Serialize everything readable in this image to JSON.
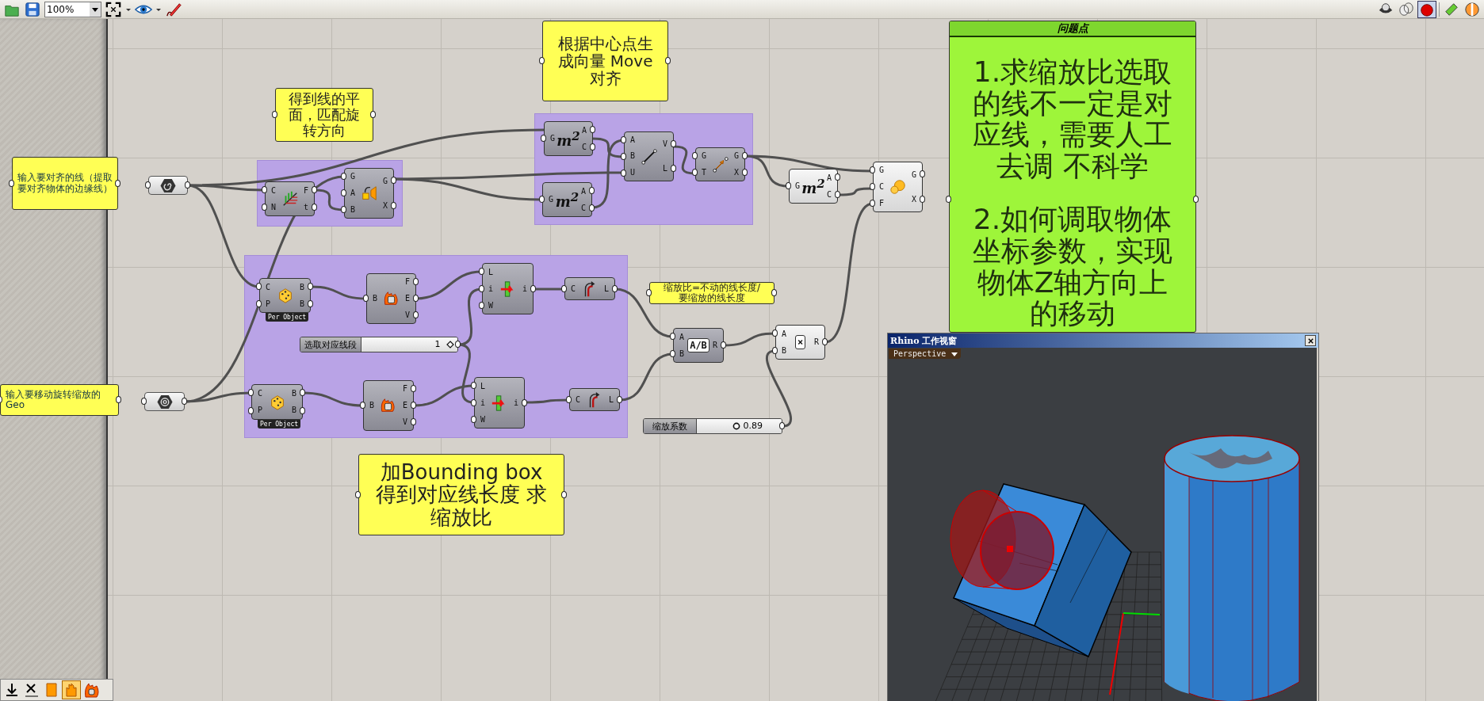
{
  "toolbar": {
    "zoom": "100%"
  },
  "panels": [
    {
      "text": "输入要对齐的线（提取要对齐物体的边缘线）"
    },
    {
      "text": "输入要移动旋转缩放的Geo"
    }
  ],
  "params": [
    {
      "kind": "curve"
    },
    {
      "kind": "geometry"
    }
  ],
  "notes": [
    {
      "text": "得到线的平面，匹配旋转方向"
    },
    {
      "text": "根据中心点生成向量 Move 对齐"
    },
    {
      "text": "缩放比=不动的线长度/要缩放的线长度"
    },
    {
      "text": "加Bounding box 得到对应线长度 求缩放比"
    }
  ],
  "components": [
    {
      "kind": "perp-frame",
      "inputs": [
        "C",
        "N"
      ],
      "outputs": [
        "F",
        "t"
      ],
      "preview": false
    },
    {
      "kind": "orient",
      "inputs": [
        "G",
        "A",
        "B"
      ],
      "outputs": [
        "G",
        "X"
      ],
      "preview": false
    },
    {
      "kind": "area",
      "icon_text": "m$^{2}$",
      "inputs": [
        "G"
      ],
      "outputs": [
        "A",
        "C"
      ],
      "preview": false
    },
    {
      "kind": "vector",
      "inputs": [
        "A",
        "B",
        "U"
      ],
      "outputs": [
        "V",
        "L"
      ],
      "preview": false
    },
    {
      "kind": "area",
      "icon_text": "m$^{2}$",
      "inputs": [
        "G"
      ],
      "outputs": [
        "A",
        "C"
      ],
      "preview": false
    },
    {
      "kind": "move",
      "inputs": [
        "G",
        "T"
      ],
      "outputs": [
        "G",
        "X"
      ],
      "preview": false
    },
    {
      "kind": "area",
      "icon_text": "m$^{2}$",
      "inputs": [
        "G"
      ],
      "outputs": [
        "A",
        "C"
      ],
      "preview": true
    },
    {
      "kind": "scale",
      "inputs": [
        "G",
        "C",
        "F"
      ],
      "outputs": [
        "G",
        "X"
      ],
      "preview": true
    },
    {
      "kind": "bbox",
      "tag": "Per Object",
      "inputs": [
        "C",
        "P"
      ],
      "outputs": [
        "B",
        "B"
      ],
      "preview": false
    },
    {
      "kind": "deconstruct",
      "inputs": [
        "B"
      ],
      "outputs": [
        "F",
        "E",
        "V"
      ],
      "preview": false
    },
    {
      "kind": "list-item",
      "inputs": [
        "L",
        "i",
        "W"
      ],
      "outputs": [
        "i"
      ],
      "preview": false
    },
    {
      "kind": "length",
      "inputs": [
        "C"
      ],
      "outputs": [
        "L"
      ],
      "preview": false
    },
    {
      "kind": "bbox",
      "tag": "Per Object",
      "inputs": [
        "C",
        "P"
      ],
      "outputs": [
        "B",
        "B"
      ],
      "preview": false
    },
    {
      "kind": "deconstruct",
      "inputs": [
        "B"
      ],
      "outputs": [
        "F",
        "E",
        "V"
      ],
      "preview": false
    },
    {
      "kind": "list-item",
      "inputs": [
        "L",
        "i",
        "W"
      ],
      "outputs": [
        "i"
      ],
      "preview": false
    },
    {
      "kind": "length",
      "inputs": [
        "C"
      ],
      "outputs": [
        "L"
      ],
      "preview": false
    },
    {
      "kind": "division",
      "icon_text": "A/B",
      "inputs": [
        "A",
        "B"
      ],
      "outputs": [
        "R"
      ],
      "preview": false
    },
    {
      "kind": "multiplication",
      "icon_text": "×",
      "inputs": [
        "A",
        "B"
      ],
      "outputs": [
        "R"
      ],
      "preview": true
    }
  ],
  "sliders": [
    {
      "kind": "integer",
      "label": "选取对应线段",
      "value": "1",
      "level": 0.9
    },
    {
      "kind": "float",
      "label": "缩放系数",
      "value": "0.89",
      "level": 0.45
    }
  ],
  "problem_panel": {
    "title": "问题点",
    "paragraphs": [
      "1.求缩放比选取的线不一定是对应线，需要人工去调 不科学",
      "2.如何调取物体坐标参数，实现物体Z轴方向上的移动"
    ]
  },
  "rhino_window": {
    "title": "Rhino 工作视窗",
    "viewport": "Perspective"
  }
}
